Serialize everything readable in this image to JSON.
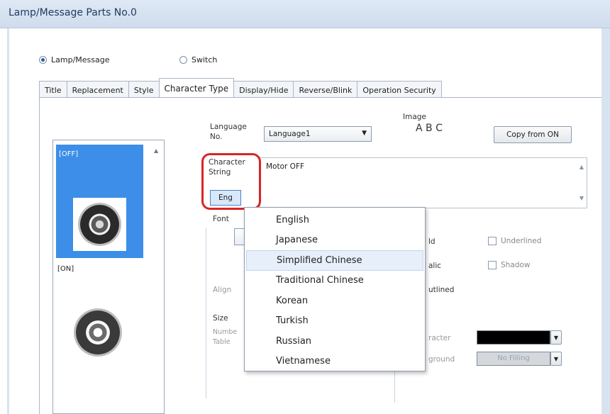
{
  "window": {
    "title": "Lamp/Message Parts No.0"
  },
  "mode": {
    "options": [
      {
        "label": "Lamp/Message",
        "checked": true
      },
      {
        "label": "Switch",
        "checked": false
      }
    ]
  },
  "tabs": [
    {
      "label": "Title",
      "active": false
    },
    {
      "label": "Replacement",
      "active": false
    },
    {
      "label": "Style",
      "active": false
    },
    {
      "label": "Character Type",
      "active": true
    },
    {
      "label": "Display/Hide",
      "active": false
    },
    {
      "label": "Reverse/Blink",
      "active": false
    },
    {
      "label": "Operation Security",
      "active": false
    }
  ],
  "states": [
    {
      "label": "[OFF]",
      "selected": true
    },
    {
      "label": "[ON]",
      "selected": false
    }
  ],
  "language": {
    "label": "Language No.",
    "value": "Language1"
  },
  "image": {
    "label": "Image",
    "preview": "A B C"
  },
  "copy_button": "Copy from ON",
  "character_string": {
    "label": "Character String",
    "value": "Motor OFF",
    "lang_button": "Eng"
  },
  "font": {
    "label": "Font"
  },
  "options": {
    "bold_partial": "ld",
    "italic_partial": "alic",
    "outline_partial": "utlined",
    "underlined": "Underlined",
    "shadow": "Shadow"
  },
  "align_partial": "Align",
  "size": {
    "label": "Size",
    "number_line1": "Numbe",
    "number_line2": "Table"
  },
  "color": {
    "character_partial": "racter",
    "character_value": "#000000",
    "background_partial": "ground",
    "background_value": "No Filling"
  },
  "language_menu": {
    "items": [
      "English",
      "Japanese",
      "Simplified Chinese",
      "Traditional Chinese",
      "Korean",
      "Turkish",
      "Russian",
      "Vietnamese"
    ],
    "selected": "Simplified Chinese"
  }
}
